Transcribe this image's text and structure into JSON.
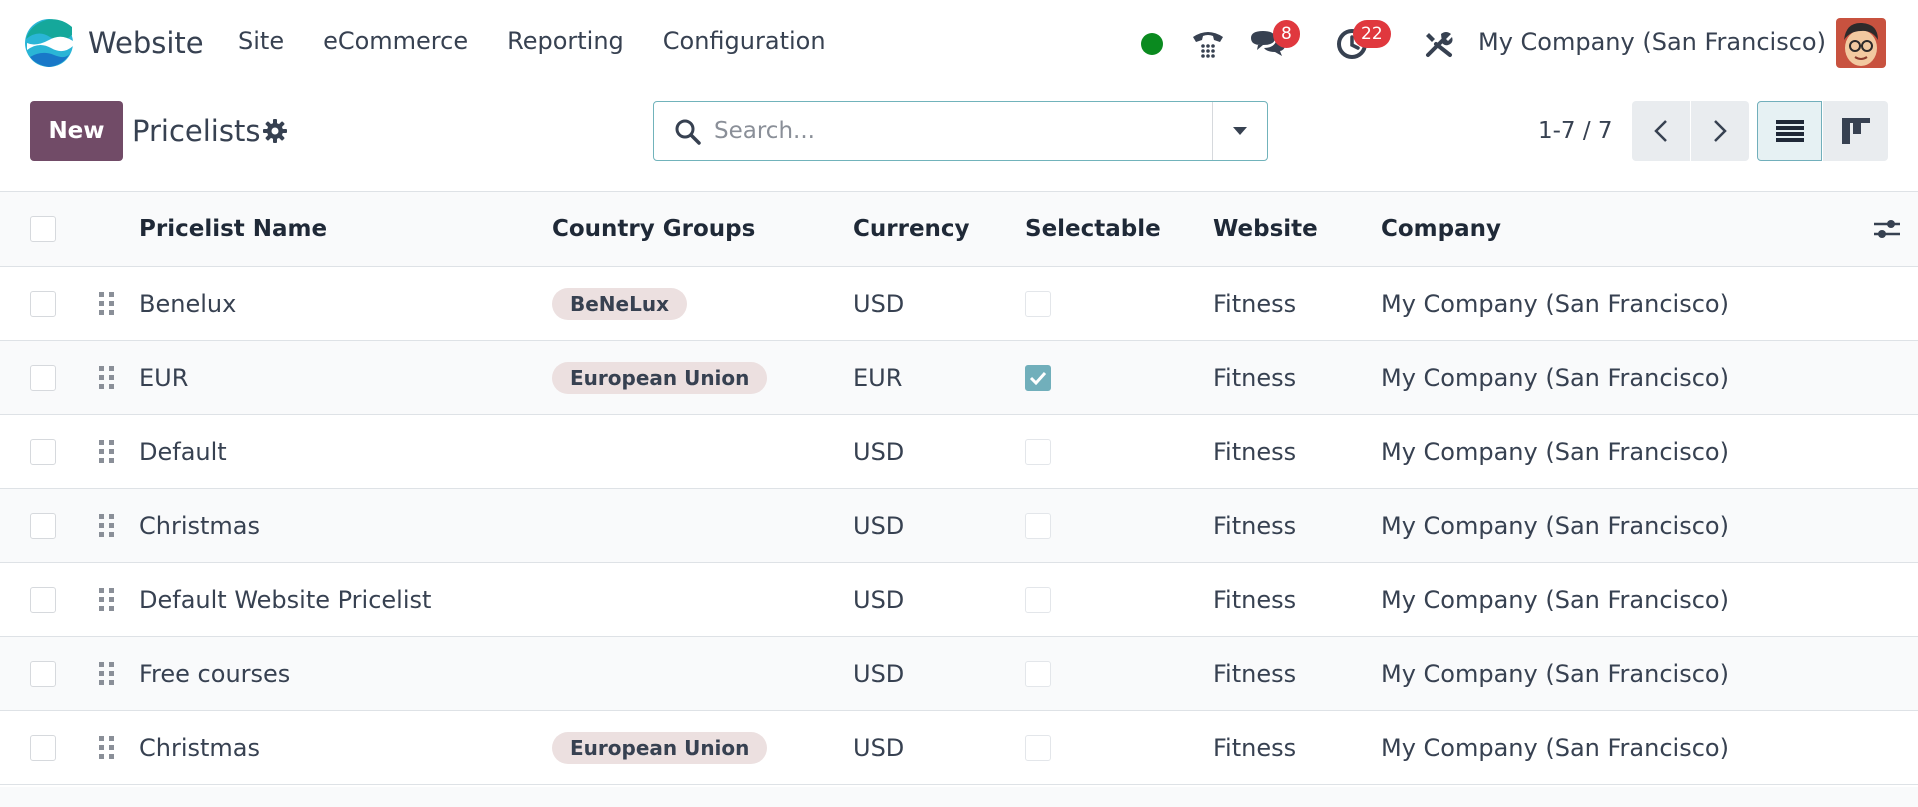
{
  "app": {
    "name": "Website"
  },
  "menu": [
    "Site",
    "eCommerce",
    "Reporting",
    "Configuration"
  ],
  "systray": {
    "messages_count": "8",
    "activities_count": "22",
    "company": "My Company (San Francisco)"
  },
  "control_panel": {
    "new_label": "New",
    "title": "Pricelists",
    "search_placeholder": "Search...",
    "pager": "1-7 / 7"
  },
  "table": {
    "headers": {
      "name": "Pricelist Name",
      "country_groups": "Country Groups",
      "currency": "Currency",
      "selectable": "Selectable",
      "website": "Website",
      "company": "Company"
    },
    "rows": [
      {
        "name": "Benelux",
        "country_group": "BeNeLux",
        "currency": "USD",
        "selectable": false,
        "website": "Fitness",
        "company": "My Company (San Francisco)"
      },
      {
        "name": "EUR",
        "country_group": "European Union",
        "currency": "EUR",
        "selectable": true,
        "website": "Fitness",
        "company": "My Company (San Francisco)"
      },
      {
        "name": "Default",
        "country_group": "",
        "currency": "USD",
        "selectable": false,
        "website": "Fitness",
        "company": "My Company (San Francisco)"
      },
      {
        "name": "Christmas",
        "country_group": "",
        "currency": "USD",
        "selectable": false,
        "website": "Fitness",
        "company": "My Company (San Francisco)"
      },
      {
        "name": "Default Website Pricelist",
        "country_group": "",
        "currency": "USD",
        "selectable": false,
        "website": "Fitness",
        "company": "My Company (San Francisco)"
      },
      {
        "name": "Free courses",
        "country_group": "",
        "currency": "USD",
        "selectable": false,
        "website": "Fitness",
        "company": "My Company (San Francisco)"
      },
      {
        "name": "Christmas",
        "country_group": "European Union",
        "currency": "USD",
        "selectable": false,
        "website": "Fitness",
        "company": "My Company (San Francisco)"
      }
    ]
  },
  "colors": {
    "primary": "#714b67",
    "badge": "#e0383e",
    "presence": "#0a8a1f",
    "checkbox_checked": "#71afbb",
    "tag_bg": "#ece0e0"
  },
  "icons": {
    "brand": "website-logo-icon",
    "phone": "phone-icon",
    "messages": "chat-bubbles-icon",
    "activities": "clock-icon",
    "debug": "tools-icon",
    "settings": "gear-icon",
    "search": "search-icon",
    "dropdown": "caret-down-icon",
    "prev": "chevron-left-icon",
    "next": "chevron-right-icon",
    "list_view": "list-view-icon",
    "kanban_view": "kanban-view-icon",
    "optional_columns": "sliders-icon",
    "drag": "drag-handle-icon"
  }
}
